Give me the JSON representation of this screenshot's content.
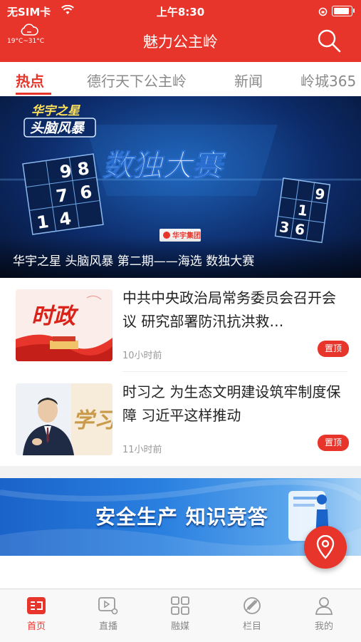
{
  "status_bar": {
    "carrier": "无SIM卡",
    "time": "上午8:30"
  },
  "header": {
    "title": "魅力公主岭",
    "weather_temp": "19°C~31°C",
    "weather_icon": "cloud-icon",
    "search_icon": "search-icon"
  },
  "tabs": [
    {
      "label": "热点",
      "active": true
    },
    {
      "label": "德行天下公主岭",
      "active": false
    },
    {
      "label": "新闻",
      "active": false
    },
    {
      "label": "岭城365",
      "active": false
    }
  ],
  "banner": {
    "caption": "华宇之星 头脑风暴 第二期——海选 数独大赛",
    "logo_line1": "华宇之星",
    "logo_line2": "头脑风暴",
    "headline": "数独大赛",
    "sponsor": "华宇集团",
    "left_grid": [
      "9",
      "8",
      "7",
      "6",
      "1",
      "4"
    ],
    "right_grid": [
      "9",
      "1",
      "3",
      "6"
    ],
    "slide_count": 3,
    "active_slide": 3
  },
  "news": [
    {
      "thumb_text": "时政",
      "title": "中共中央政治局常务委员会召开会议 研究部署防汛抗洪救…",
      "time": "10小时前",
      "badge": "置顶"
    },
    {
      "thumb_text": "学习",
      "title": "时习之 为生态文明建设筑牢制度保障 习近平这样推动",
      "time": "11小时前",
      "badge": "置顶"
    }
  ],
  "ad": {
    "text": "安全生产 知识竞答"
  },
  "fab_icon": "location-pin-icon",
  "bottom_nav": [
    {
      "label": "首页",
      "icon": "home-news-icon",
      "active": true
    },
    {
      "label": "直播",
      "icon": "live-play-icon",
      "active": false
    },
    {
      "label": "融媒",
      "icon": "grid-icon",
      "active": false
    },
    {
      "label": "栏目",
      "icon": "column-icon",
      "active": false
    },
    {
      "label": "我的",
      "icon": "user-icon",
      "active": false
    }
  ],
  "colors": {
    "brand_red": "#e8352b",
    "inactive_gray": "#888888"
  }
}
